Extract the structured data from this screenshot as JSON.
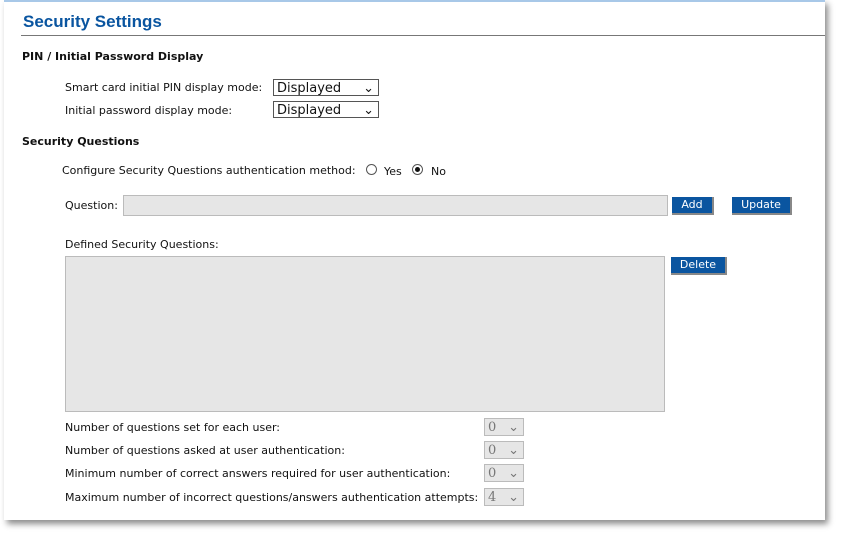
{
  "title": "Security Settings",
  "pin_section": {
    "heading": "PIN / Initial Password Display",
    "smart_card_label": "Smart card initial PIN display mode:",
    "smart_card_value": "Displayed",
    "initial_password_label": "Initial password display mode:",
    "initial_password_value": "Displayed"
  },
  "questions_section": {
    "heading": "Security Questions",
    "configure_label": "Configure Security Questions authentication method:",
    "yes_label": "Yes",
    "no_label": "No",
    "selected": "No",
    "question_label": "Question:",
    "question_value": "",
    "add_label": "Add",
    "update_label": "Update",
    "defined_label": "Defined Security Questions:",
    "delete_label": "Delete",
    "settings": [
      {
        "label": "Number of questions set for each user:",
        "value": "0"
      },
      {
        "label": "Number of questions asked at user authentication:",
        "value": "0"
      },
      {
        "label": "Minimum number of correct answers required for user authentication:",
        "value": "0"
      },
      {
        "label": "Maximum number of incorrect questions/answers authentication attempts:",
        "value": "4"
      }
    ]
  }
}
